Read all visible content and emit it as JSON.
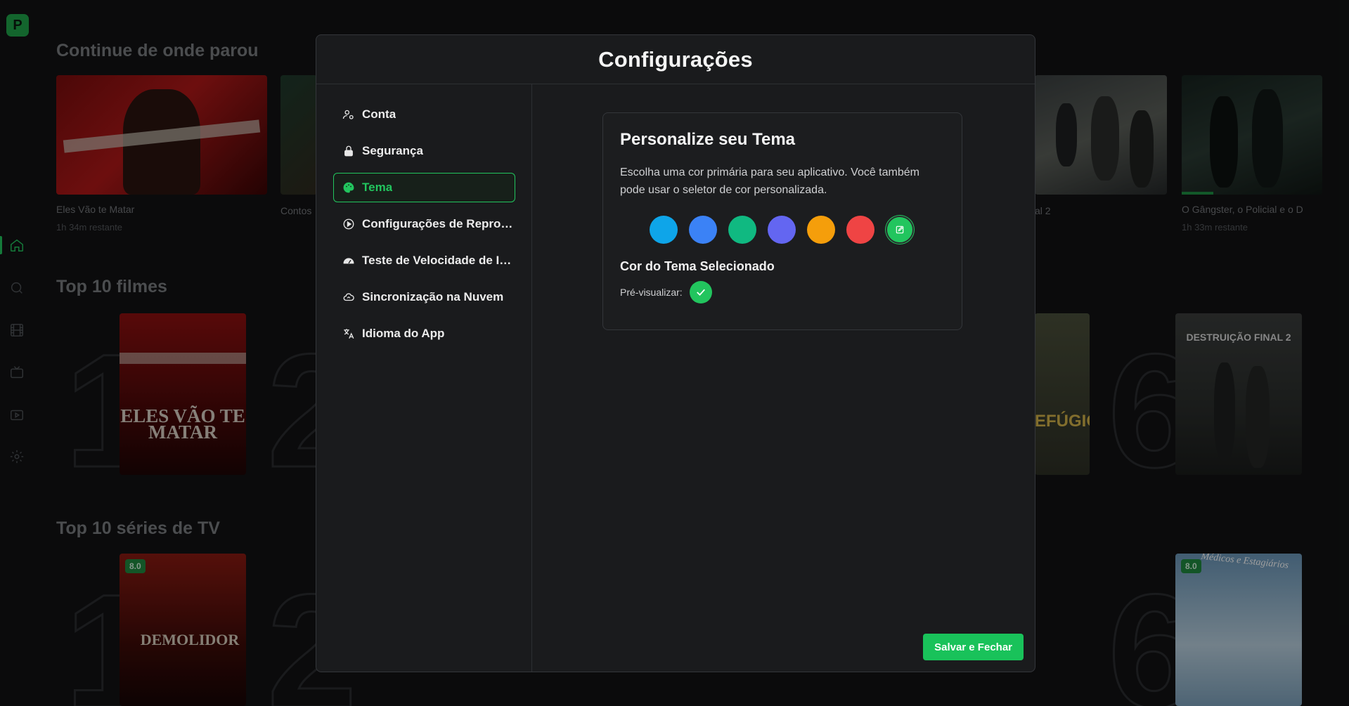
{
  "app": {
    "logo_letter": "P",
    "sidebar_icons": [
      "home-icon",
      "search-icon",
      "film-icon",
      "tv-icon",
      "playlist-icon",
      "gear-icon"
    ]
  },
  "background": {
    "continue_title": "Continue de onde parou",
    "continue_items": [
      {
        "title": "Eles Vão te Matar",
        "remaining": "1h 34m restante"
      },
      {
        "title": "Contos",
        "remaining": ""
      },
      {
        "title": "al 2",
        "remaining": ""
      },
      {
        "title": "O Gângster, o Policial e o D",
        "remaining": "1h 33m restante"
      }
    ],
    "top_movies_title": "Top 10 filmes",
    "top_series_title": "Top 10 séries de TV",
    "rank_numbers": [
      "1",
      "2",
      "6"
    ],
    "poster_texts": {
      "eles_vao": "ELES VÃO TE MATAR",
      "refugio": "EFÚGIO",
      "destruicao": "DESTRUIÇÃO FINAL 2",
      "demolidor": "DEMOLIDOR",
      "medicos": "Médicos e Estagiários"
    },
    "ratings": [
      "8.0",
      "8.0"
    ]
  },
  "modal": {
    "title": "Configurações",
    "nav": [
      {
        "label": "Conta",
        "icon": "user-gear-icon"
      },
      {
        "label": "Segurança",
        "icon": "lock-icon"
      },
      {
        "label": "Tema",
        "icon": "palette-icon"
      },
      {
        "label": "Configurações de Reprodução",
        "icon": "play-circle-icon"
      },
      {
        "label": "Teste de Velocidade de Internet",
        "icon": "gauge-icon"
      },
      {
        "label": "Sincronização na Nuvem",
        "icon": "cloud-sync-icon"
      },
      {
        "label": "Idioma do App",
        "icon": "translate-icon"
      }
    ],
    "active_nav": "Tema",
    "theme": {
      "title": "Personalize seu Tema",
      "description": "Escolha uma cor primária para seu aplicativo. Você também pode usar o seletor de cor personalizada.",
      "swatches": [
        "#0ea5e9",
        "#3b82f6",
        "#10b981",
        "#6366f1",
        "#f59e0b",
        "#ef4444",
        "#22c55e"
      ],
      "selected_title": "Cor do Tema Selecionado",
      "preview_label": "Pré-visualizar:",
      "selected_color": "#22c55e"
    },
    "save_label": "Salvar e Fechar"
  }
}
